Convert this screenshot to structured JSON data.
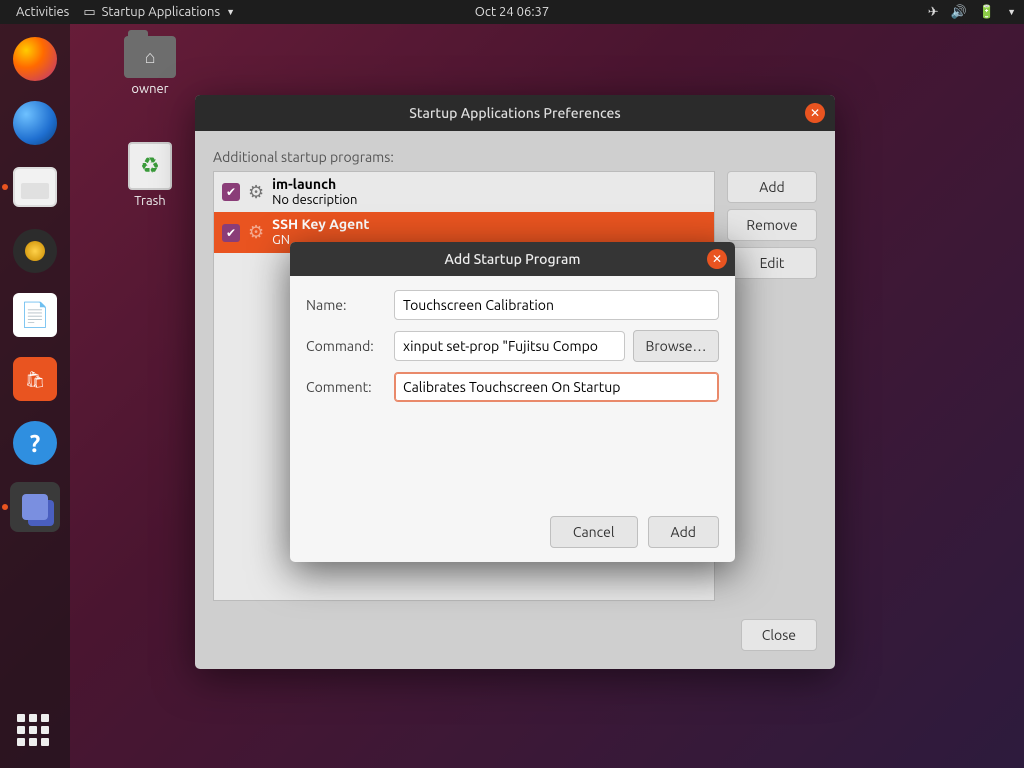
{
  "topbar": {
    "activities": "Activities",
    "appmenu": "Startup Applications",
    "datetime": "Oct 24  06:37"
  },
  "desktop": {
    "owner": "owner",
    "trash": "Trash"
  },
  "prefwin": {
    "title": "Startup Applications Preferences",
    "listlabel": "Additional startup programs:",
    "rows": [
      {
        "name": "im-launch",
        "desc": "No description"
      },
      {
        "name": "SSH Key Agent",
        "desc": "GN"
      }
    ],
    "add": "Add",
    "remove": "Remove",
    "edit": "Edit",
    "close": "Close"
  },
  "modal": {
    "title": "Add Startup Program",
    "name_label": "Name:",
    "command_label": "Command:",
    "comment_label": "Comment:",
    "name_value": "Touchscreen Calibration",
    "command_value": "xinput set-prop \"Fujitsu Compo",
    "comment_value": "Calibrates Touchscreen On Startup",
    "browse": "Browse…",
    "cancel": "Cancel",
    "add": "Add"
  }
}
